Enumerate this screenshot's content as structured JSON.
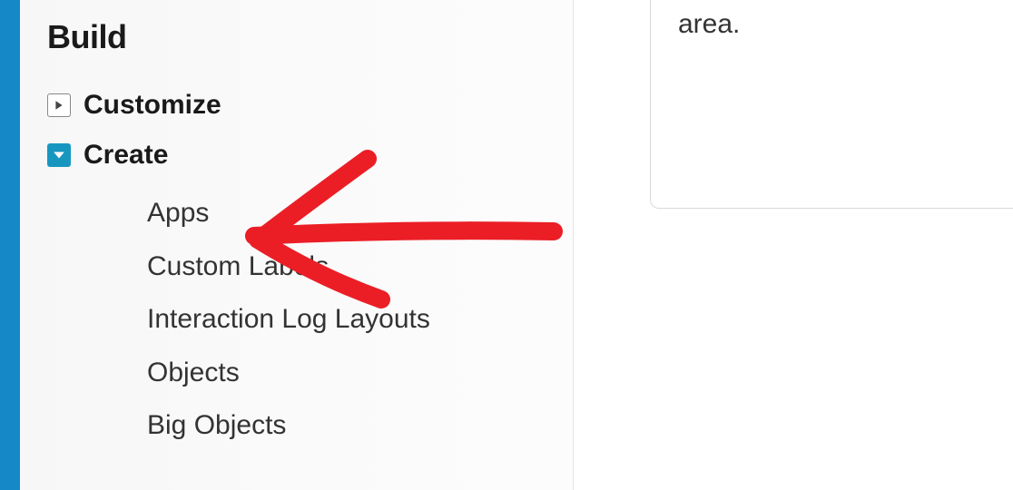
{
  "sidebar": {
    "section_title": "Build",
    "items": [
      {
        "label": "Customize",
        "expanded": false
      },
      {
        "label": "Create",
        "expanded": true,
        "children": [
          "Apps",
          "Custom Labels",
          "Interaction Log Layouts",
          "Objects",
          "Big Objects"
        ]
      }
    ]
  },
  "right_panel": {
    "visible_text": "area."
  },
  "colors": {
    "stripe": "#1589c8",
    "expanded_icon_bg": "#1797c0",
    "annotation": "#eb1e26"
  }
}
